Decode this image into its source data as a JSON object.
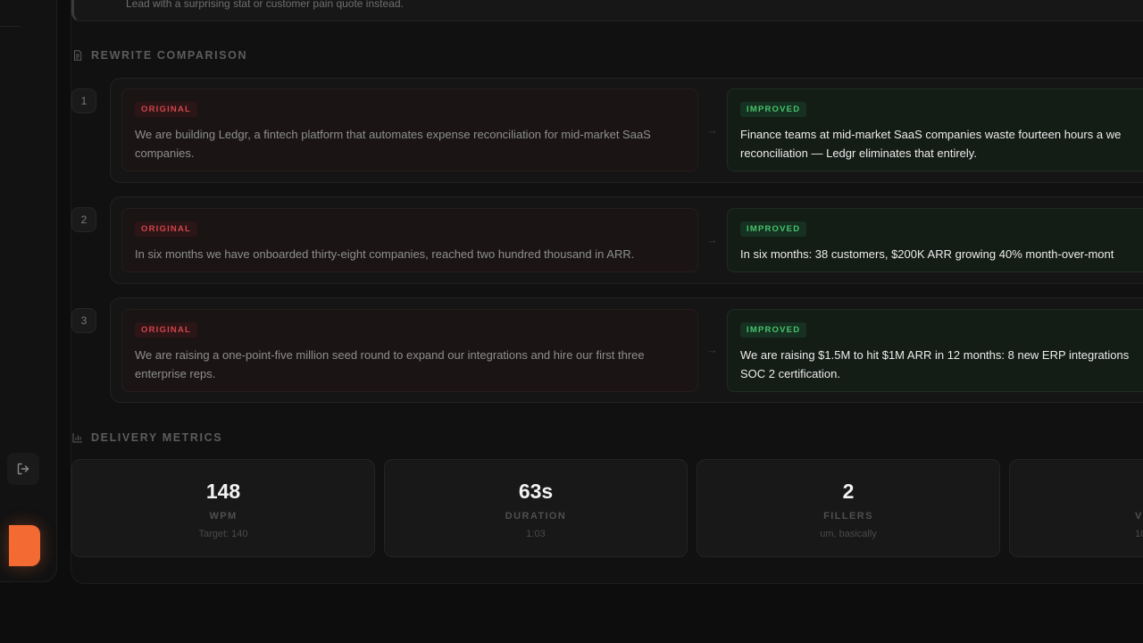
{
  "top_card": {
    "text": "Lead with a surprising stat or customer pain quote instead."
  },
  "rewrite_section": {
    "title": "REWRITE COMPARISON",
    "rows": [
      {
        "number": "1",
        "original_tag": "ORIGINAL",
        "original_text": "We are building Ledgr, a fintech platform that automates expense reconciliation for mid-market SaaS companies.",
        "improved_tag": "IMPROVED",
        "improved_line1": "Finance teams at mid-market SaaS companies waste fourteen hours a we",
        "improved_line2": "reconciliation — Ledgr eliminates that entirely."
      },
      {
        "number": "2",
        "original_tag": "ORIGINAL",
        "original_text": "In six months we have onboarded thirty-eight companies, reached two hundred thousand in ARR.",
        "improved_tag": "IMPROVED",
        "improved_line1": "In six months: 38 customers, $200K ARR growing 40% month-over-mont",
        "improved_line2": ""
      },
      {
        "number": "3",
        "original_tag": "ORIGINAL",
        "original_text": "We are raising a one-point-five million seed round to expand our integrations and hire our first three enterprise reps.",
        "improved_tag": "IMPROVED",
        "improved_line1": "We are raising $1.5M to hit $1M ARR in 12 months: 8 new ERP integrations",
        "improved_line2": "SOC 2 certification."
      }
    ]
  },
  "metrics_section": {
    "title": "DELIVERY METRICS",
    "cards": [
      {
        "value": "148",
        "label": "WPM",
        "sub": "Target: 140"
      },
      {
        "value": "63s",
        "label": "DURATION",
        "sub": "1:03"
      },
      {
        "value": "2",
        "label": "FILLERS",
        "sub": "um, basically"
      },
      {
        "value": "",
        "label": "V",
        "sub": "10"
      }
    ]
  },
  "colors": {
    "accent_orange": "#f36b33",
    "original_red": "#d3444c",
    "improved_green": "#46c46b"
  }
}
